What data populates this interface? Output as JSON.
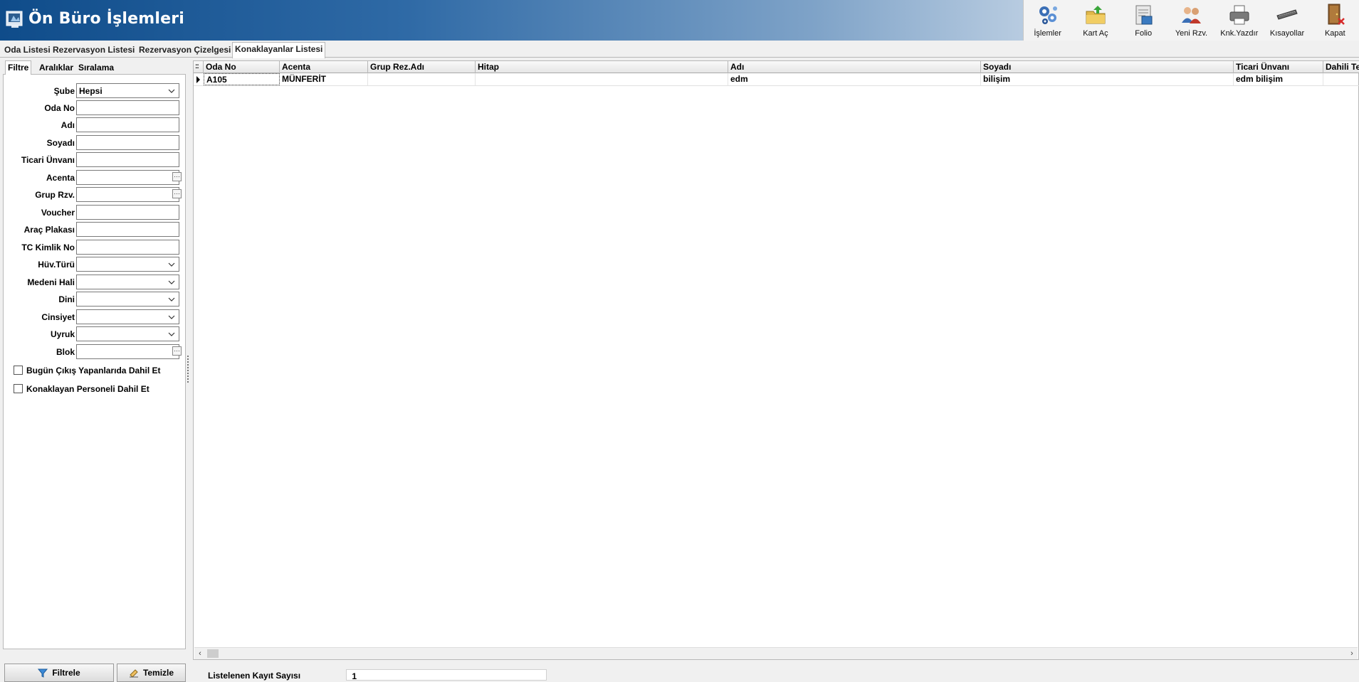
{
  "app": {
    "title": "Ön Büro İşlemleri"
  },
  "toolbar": [
    {
      "label": "İşlemler",
      "icon": "gears-icon"
    },
    {
      "label": "Kart Aç",
      "icon": "open-card-icon"
    },
    {
      "label": "Folio",
      "icon": "folio-icon"
    },
    {
      "label": "Yeni Rzv.",
      "icon": "new-reservation-icon"
    },
    {
      "label": "Knk.Yazdır",
      "icon": "printer-icon"
    },
    {
      "label": "Kısayollar",
      "icon": "keyboard-icon"
    },
    {
      "label": "Kapat",
      "icon": "close-door-icon"
    }
  ],
  "main_tabs": [
    {
      "label": "Oda Listesi",
      "active": false
    },
    {
      "label": "Rezervasyon Listesi",
      "active": false
    },
    {
      "label": "Rezervasyon Çizelgesi",
      "active": false
    },
    {
      "label": "Konaklayanlar Listesi",
      "active": true
    }
  ],
  "filter_tabs": [
    {
      "label": "Filtre",
      "active": true
    },
    {
      "label": "Aralıklar",
      "active": false
    },
    {
      "label": "Sıralama",
      "active": false
    }
  ],
  "filters": {
    "sube": {
      "label": "Şube",
      "value": "Hepsi"
    },
    "oda_no": {
      "label": "Oda No",
      "value": ""
    },
    "adi": {
      "label": "Adı",
      "value": ""
    },
    "soyadi": {
      "label": "Soyadı",
      "value": ""
    },
    "ticari_unvani": {
      "label": "Ticari Ünvanı",
      "value": ""
    },
    "acenta": {
      "label": "Acenta",
      "value": ""
    },
    "grup_rzv": {
      "label": "Grup Rzv.",
      "value": ""
    },
    "voucher": {
      "label": "Voucher",
      "value": ""
    },
    "arac_plakasi": {
      "label": "Araç Plakası",
      "value": ""
    },
    "tc_kimlik_no": {
      "label": "TC Kimlik No",
      "value": ""
    },
    "huv_turu": {
      "label": "Hüv.Türü",
      "value": ""
    },
    "medeni_hali": {
      "label": "Medeni Hali",
      "value": ""
    },
    "dini": {
      "label": "Dini",
      "value": ""
    },
    "cinsiyet": {
      "label": "Cinsiyet",
      "value": ""
    },
    "uyruk": {
      "label": "Uyruk",
      "value": ""
    },
    "blok": {
      "label": "Blok",
      "value": ""
    }
  },
  "checkboxes": {
    "bugun_cikis": {
      "label": "Bugün Çıkış Yapanlarıda Dahil Et",
      "checked": false
    },
    "personel": {
      "label": "Konaklayan Personeli Dahil Et",
      "checked": false
    }
  },
  "buttons": {
    "filter": "Filtrele",
    "clear": "Temizle"
  },
  "grid": {
    "corner": "::",
    "columns": [
      "Oda No",
      "Acenta",
      "Grup Rez.Adı",
      "Hitap",
      "Adı",
      "Soyadı",
      "Ticari Ünvanı",
      "Dahili Te"
    ],
    "rows": [
      [
        "A105",
        "MÜNFERİT",
        "",
        "",
        "edm",
        "bilişim",
        "edm bilişim",
        ""
      ]
    ]
  },
  "status": {
    "label": "Listelenen Kayıt Sayısı",
    "count": "1"
  }
}
